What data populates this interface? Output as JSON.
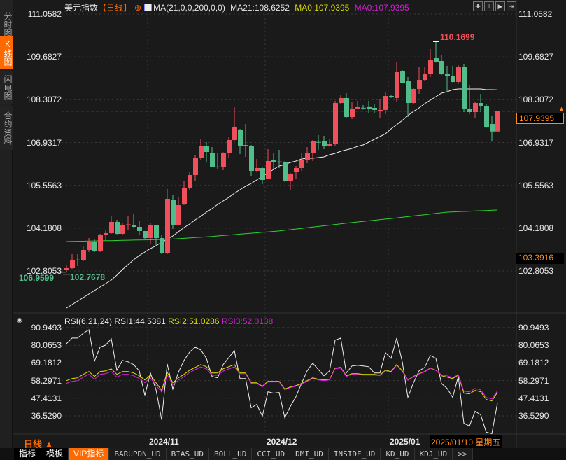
{
  "sidebar": {
    "tabs": [
      {
        "label": "分时图",
        "active": false
      },
      {
        "label": "K线图",
        "active": true
      },
      {
        "label": "闪电图",
        "active": false
      },
      {
        "label": "合约资料",
        "active": false
      }
    ]
  },
  "header": {
    "symbol": "美元指数",
    "period": "【日线】",
    "ma_params": "MA(21,0,0,200,0,0)",
    "ma21": "MA21:108.6252",
    "ma0_a": "MA0:107.9395",
    "ma0_b": "MA0:107.9395"
  },
  "toolbar_icons": [
    "crosshair-icon",
    "zoom-range-icon",
    "play-icon",
    "exit-icon"
  ],
  "rsi_header": {
    "params": "RSI(6,21,24)",
    "rsi1": "RSI1:44.5381",
    "rsi2": "RSI2:51.0286",
    "rsi3": "RSI3:52.0138"
  },
  "colors": {
    "up": "#f04f5c",
    "down": "#50bd8a",
    "ma21": "#f0f0f0",
    "ma_long": "#2fd12f",
    "rsi1": "#f0f0f0",
    "rsi2": "#e6e600",
    "rsi3": "#e020e0",
    "accent": "#ff6a00",
    "price_line": "#ff9a2a"
  },
  "price_axis": {
    "labels": [
      "111.0582",
      "109.6827",
      "108.3072",
      "106.9317",
      "105.5563",
      "104.1808",
      "102.8053"
    ],
    "max": 111.0582,
    "min": 102.8053
  },
  "rsi_axis": {
    "labels": [
      "90.9493",
      "80.0653",
      "69.1812",
      "58.2971",
      "47.4131",
      "36.5290"
    ],
    "max": 90.9493,
    "min": 36.529
  },
  "last_price": "107.9395",
  "marker_price": "103.3916",
  "annotations": {
    "high": "110.1699",
    "low": "106.9599",
    "start_low": "102.7678"
  },
  "period_label": "日线",
  "cursor_date": "2025/01/10 星期五",
  "x_ticks": [
    {
      "label": "2024/11",
      "candle": 15
    },
    {
      "label": "2024/12",
      "candle": 36
    },
    {
      "label": "2025/01",
      "candle": 58
    }
  ],
  "bottom_tabs": [
    "指标",
    "模板",
    "VIP指标",
    "BARUPDN_UD",
    "BIAS_UD",
    "BOLL_UD",
    "CCI_UD",
    "DMI_UD",
    "INSIDE_UD",
    "KD_UD",
    "KDJ_UD",
    ">>"
  ],
  "chart_data": {
    "type": "candlestick",
    "ohlc": [
      [
        102.828,
        102.986,
        102.768,
        102.896
      ],
      [
        102.896,
        103.345,
        102.87,
        103.165
      ],
      [
        103.17,
        103.345,
        102.963,
        103.16
      ],
      [
        103.143,
        103.593,
        103.12,
        103.48
      ],
      [
        103.48,
        103.862,
        103.413,
        103.728
      ],
      [
        103.728,
        103.818,
        103.41,
        103.435
      ],
      [
        103.458,
        103.997,
        103.413,
        103.952
      ],
      [
        103.952,
        104.11,
        103.795,
        104.02
      ],
      [
        104.02,
        104.559,
        104.0,
        104.38
      ],
      [
        104.38,
        104.447,
        103.98,
        103.997
      ],
      [
        103.997,
        104.335,
        103.952,
        104.29
      ],
      [
        104.29,
        104.559,
        104.11,
        104.3
      ],
      [
        104.267,
        104.627,
        104.21,
        104.222
      ],
      [
        104.222,
        104.425,
        103.952,
        104.087
      ],
      [
        104.087,
        104.09,
        103.84,
        103.862
      ],
      [
        103.862,
        104.335,
        103.683,
        104.267
      ],
      [
        104.267,
        104.29,
        103.593,
        103.862
      ],
      [
        103.862,
        103.952,
        103.35,
        103.368
      ],
      [
        103.368,
        105.437,
        103.345,
        105.122
      ],
      [
        105.099,
        105.234,
        104.155,
        104.29
      ],
      [
        104.29,
        105.189,
        104.27,
        104.919
      ],
      [
        104.964,
        105.684,
        104.919,
        105.459
      ],
      [
        105.459,
        105.999,
        105.414,
        105.886
      ],
      [
        105.886,
        106.538,
        105.684,
        106.426
      ],
      [
        106.426,
        107.056,
        106.359,
        106.808
      ],
      [
        106.808,
        106.943,
        106.314,
        106.628
      ],
      [
        106.606,
        106.786,
        106.14,
        106.156
      ],
      [
        106.16,
        106.606,
        106.089,
        106.15
      ],
      [
        106.134,
        106.62,
        106.044,
        106.606
      ],
      [
        106.606,
        107.123,
        106.426,
        107.011
      ],
      [
        107.011,
        108.068,
        106.99,
        107.438
      ],
      [
        107.348,
        107.37,
        106.561,
        106.831
      ],
      [
        106.85,
        107.528,
        106.471,
        106.84
      ],
      [
        106.831,
        106.85,
        105.841,
        106.021
      ],
      [
        106.021,
        106.404,
        106.0,
        106.111
      ],
      [
        106.111,
        106.13,
        105.594,
        105.729
      ],
      [
        105.774,
        106.718,
        105.75,
        106.336
      ],
      [
        106.359,
        106.583,
        106.089,
        106.291
      ],
      [
        106.32,
        106.696,
        106.111,
        106.31
      ],
      [
        106.314,
        106.33,
        105.67,
        105.684
      ],
      [
        105.684,
        105.95,
        105.392,
        105.931
      ],
      [
        105.976,
        106.179,
        105.774,
        106.111
      ],
      [
        106.111,
        106.606,
        106.021,
        106.359
      ],
      [
        106.359,
        106.786,
        106.269,
        106.606
      ],
      [
        106.606,
        107.011,
        106.336,
        106.966
      ],
      [
        106.95,
        107.168,
        106.696,
        106.943
      ],
      [
        106.988,
        107.146,
        106.718,
        106.808
      ],
      [
        106.808,
        107.056,
        106.8,
        106.898
      ],
      [
        106.898,
        108.27,
        106.831,
        108.202
      ],
      [
        108.202,
        108.45,
        108.18,
        108.36
      ],
      [
        108.36,
        108.517,
        107.73,
        107.753
      ],
      [
        107.753,
        108.247,
        107.685,
        108.023
      ],
      [
        108.023,
        108.27,
        108.0,
        108.068
      ],
      [
        108.05,
        108.135,
        107.99,
        108.04
      ],
      [
        108.07,
        108.27,
        107.888,
        108.02
      ],
      [
        108.045,
        108.157,
        107.865,
        107.978
      ],
      [
        107.955,
        108.337,
        107.73,
        107.978
      ],
      [
        107.978,
        108.562,
        107.843,
        108.427
      ],
      [
        108.427,
        108.472,
        108.36,
        108.382
      ],
      [
        108.36,
        109.507,
        108.225,
        109.192
      ],
      [
        109.214,
        109.259,
        108.84,
        108.854
      ],
      [
        108.899,
        109.034,
        107.753,
        108.202
      ],
      [
        108.202,
        108.697,
        108.18,
        108.652
      ],
      [
        108.652,
        109.372,
        108.495,
        108.944
      ],
      [
        108.944,
        109.349,
        108.92,
        109.124
      ],
      [
        109.124,
        109.934,
        109.034,
        109.597
      ],
      [
        109.642,
        110.1699,
        109.5,
        109.529
      ],
      [
        109.552,
        109.732,
        109.1,
        109.124
      ],
      [
        109.124,
        109.394,
        108.562,
        109.057
      ],
      [
        109.057,
        109.394,
        108.86,
        108.877
      ],
      [
        108.877,
        109.417,
        108.81,
        109.349
      ],
      [
        109.349,
        109.439,
        107.91,
        108.023
      ],
      [
        108.023,
        108.765,
        107.843,
        107.91
      ],
      [
        107.91,
        108.247,
        107.73,
        108.202
      ],
      [
        108.202,
        108.495,
        107.91,
        108.09
      ],
      [
        108.09,
        108.157,
        107.4,
        107.415
      ],
      [
        107.528,
        107.775,
        106.9599,
        107.286
      ],
      [
        107.286,
        107.955,
        107.26,
        107.9395
      ]
    ],
    "ma21": [
      101.614,
      101.726,
      101.839,
      101.951,
      102.063,
      102.176,
      102.288,
      102.401,
      102.513,
      102.671,
      102.851,
      103.008,
      103.165,
      103.3,
      103.413,
      103.525,
      103.615,
      103.728,
      103.818,
      103.93,
      104.065,
      104.2,
      104.312,
      104.447,
      104.559,
      104.694,
      104.807,
      104.942,
      105.054,
      105.167,
      105.302,
      105.414,
      105.527,
      105.617,
      105.729,
      105.841,
      105.954,
      106.066,
      106.179,
      106.224,
      106.291,
      106.336,
      106.404,
      106.426,
      106.426,
      106.449,
      106.471,
      106.538,
      106.583,
      106.651,
      106.696,
      106.741,
      106.808,
      106.853,
      106.943,
      107.033,
      107.123,
      107.213,
      107.37,
      107.505,
      107.64,
      107.798,
      107.933,
      108.045,
      108.18,
      108.292,
      108.405,
      108.517,
      108.562,
      108.63,
      108.652,
      108.652,
      108.652,
      108.652,
      108.652,
      108.63,
      108.63,
      108.625
    ],
    "ma_long": [
      103.75,
      103.754,
      103.758,
      103.761,
      103.765,
      103.769,
      103.773,
      103.777,
      103.78,
      103.784,
      103.788,
      103.792,
      103.796,
      103.799,
      103.803,
      103.807,
      103.811,
      103.815,
      103.818,
      103.83,
      103.842,
      103.853,
      103.865,
      103.877,
      103.888,
      103.9,
      103.915,
      103.929,
      103.944,
      103.958,
      103.973,
      103.988,
      104.002,
      104.017,
      104.031,
      104.046,
      104.061,
      104.075,
      104.09,
      104.111,
      104.132,
      104.152,
      104.173,
      104.194,
      104.215,
      104.236,
      104.256,
      104.277,
      104.298,
      104.319,
      104.34,
      104.36,
      104.379,
      104.397,
      104.416,
      104.434,
      104.453,
      104.472,
      104.49,
      104.51,
      104.531,
      104.551,
      104.572,
      104.592,
      104.612,
      104.633,
      104.653,
      104.674,
      104.694,
      104.702,
      104.709,
      104.717,
      104.724,
      104.732,
      104.74,
      104.747,
      104.755,
      104.762
    ],
    "rsi1": [
      81.05,
      84.5,
      84.5,
      87.51,
      89.66,
      70.3,
      78.9,
      80.19,
      84.07,
      64.71,
      70.73,
      69.87,
      68.15,
      64.28,
      49.22,
      62.99,
      52.66,
      34.16,
      68.58,
      53.09,
      63.42,
      70.73,
      75.89,
      78.9,
      77.18,
      72.02,
      60.83,
      59.97,
      68.15,
      72.45,
      76.75,
      59.54,
      59.54,
      41.48,
      43.63,
      36.31,
      51.37,
      50.51,
      50.94,
      35.45,
      42.34,
      48.36,
      56.53,
      64.28,
      69.01,
      65.14,
      61.26,
      64.28,
      83.21,
      84.5,
      62.99,
      67.29,
      67.72,
      67.29,
      66.86,
      62.99,
      62.99,
      75.46,
      72.02,
      84.5,
      69.87,
      47.93,
      56.96,
      64.28,
      66.43,
      73.74,
      72.02,
      56.53,
      53.52,
      47.93,
      60.83,
      32.01,
      30.29,
      39.33,
      37.18,
      26.42,
      25.56,
      44.54
    ],
    "rsi2": [
      58.26,
      59.54,
      59.97,
      62.13,
      63.85,
      60.83,
      63.85,
      64.28,
      65.57,
      62.13,
      63.85,
      63.85,
      62.99,
      61.26,
      58.68,
      61.7,
      56.96,
      52.23,
      63.42,
      56.96,
      59.97,
      62.13,
      64.71,
      66.43,
      68.15,
      66.86,
      62.99,
      62.99,
      65.57,
      66.86,
      68.15,
      62.99,
      62.99,
      56.96,
      56.96,
      54.81,
      57.83,
      57.83,
      57.83,
      53.09,
      54.38,
      55.24,
      56.53,
      58.26,
      59.97,
      59.11,
      58.68,
      59.11,
      66.0,
      66.43,
      61.26,
      62.56,
      62.56,
      62.13,
      62.13,
      62.13,
      61.7,
      64.71,
      63.85,
      68.15,
      64.28,
      58.68,
      60.83,
      62.56,
      63.85,
      66.0,
      64.71,
      61.26,
      60.4,
      59.54,
      61.7,
      50.51,
      50.08,
      52.23,
      51.37,
      46.64,
      45.78,
      51.03
    ],
    "rsi3": [
      56.56,
      57.84,
      58.27,
      60.43,
      62.15,
      59.13,
      62.15,
      62.58,
      63.87,
      60.43,
      62.15,
      62.15,
      61.29,
      59.56,
      56.98,
      60.0,
      55.26,
      51.23,
      61.72,
      55.76,
      58.57,
      60.73,
      63.31,
      65.03,
      66.75,
      65.46,
      61.59,
      61.59,
      64.17,
      65.46,
      66.75,
      62.59,
      62.59,
      56.56,
      56.56,
      54.41,
      57.43,
      57.43,
      57.43,
      52.69,
      53.98,
      54.84,
      56.13,
      57.86,
      59.57,
      58.71,
      58.28,
      58.71,
      65.6,
      66.03,
      60.86,
      62.16,
      62.16,
      61.73,
      61.73,
      61.73,
      61.3,
      64.31,
      63.45,
      67.75,
      63.88,
      58.48,
      60.63,
      62.36,
      63.65,
      65.8,
      64.51,
      61.9,
      61.2,
      60.2,
      61.9,
      51.7,
      51.3,
      53.4,
      52.6,
      47.9,
      47.0,
      52.01
    ]
  }
}
